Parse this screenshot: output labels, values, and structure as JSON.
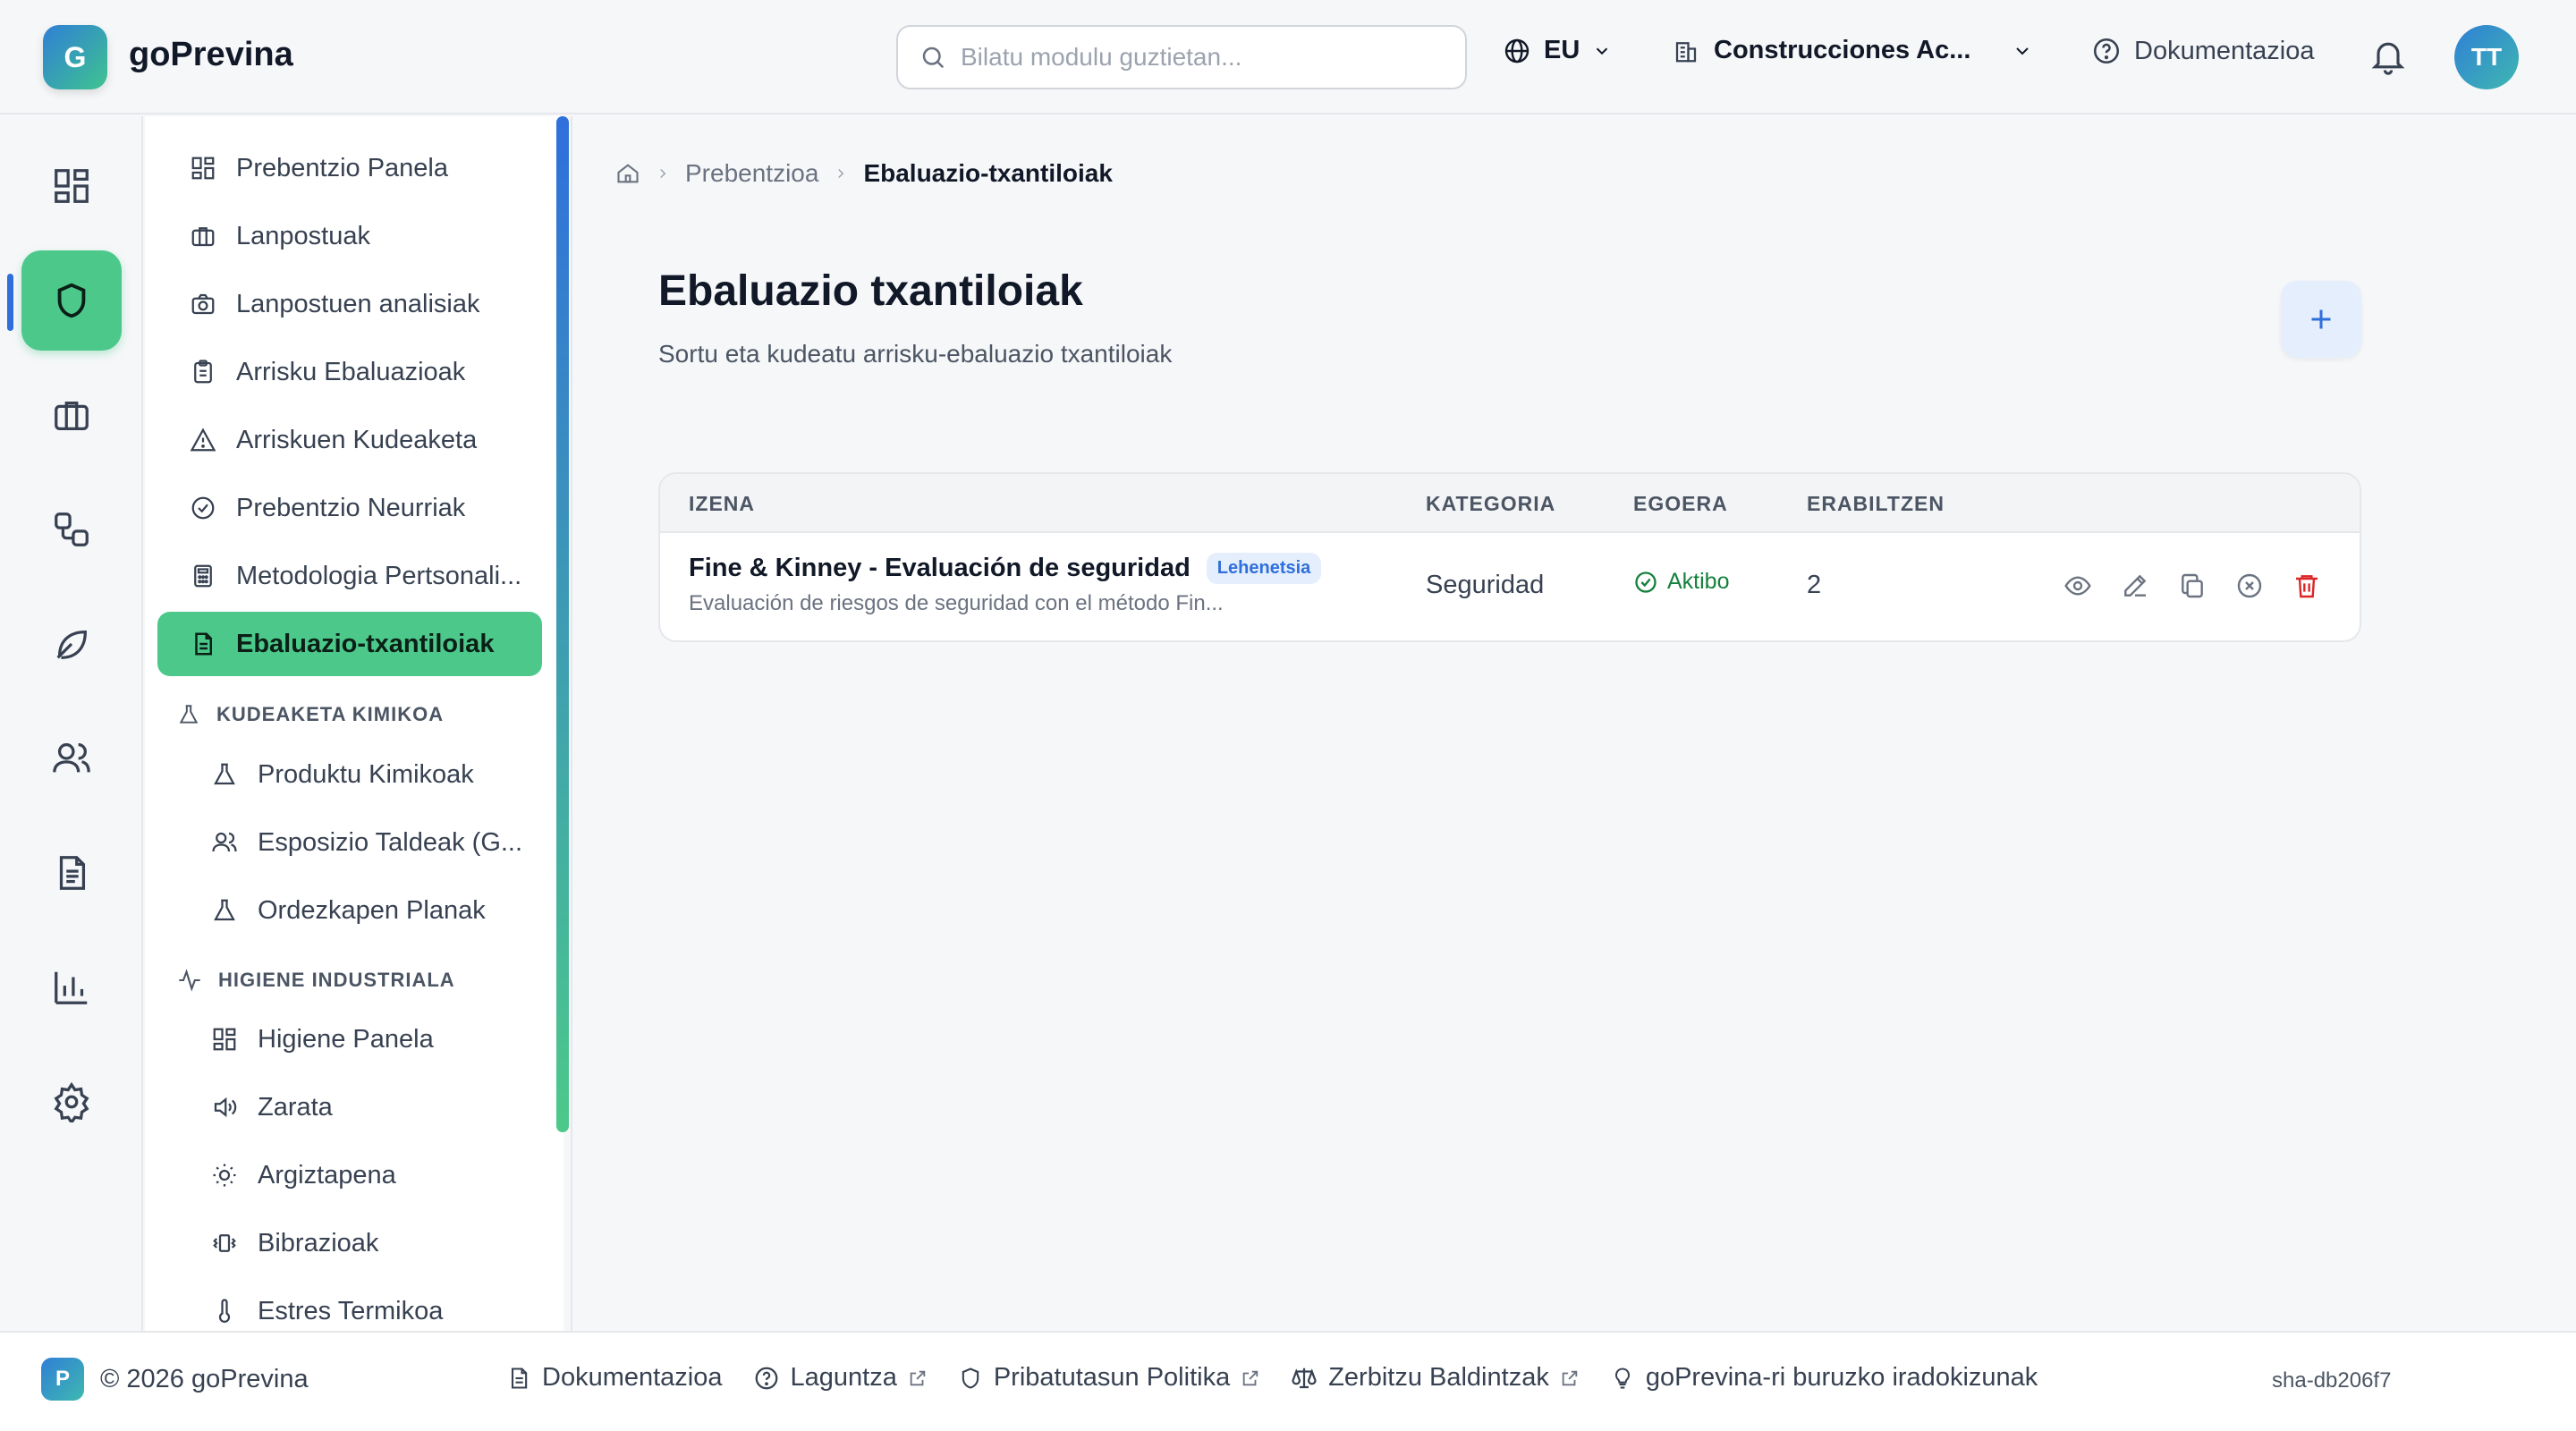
{
  "header": {
    "logo_letter": "G",
    "app_name": "goPrevina",
    "search_placeholder": "Bilatu modulu guztietan...",
    "language": "EU",
    "organization": "Construcciones Ac...",
    "docs_label": "Dokumentazioa",
    "avatar_initials": "TT"
  },
  "rail": {
    "items": [
      {
        "icon": "dashboard-icon",
        "active": false
      },
      {
        "icon": "shield-icon",
        "active": true
      },
      {
        "icon": "briefcase-icon",
        "active": false
      },
      {
        "icon": "shapes-icon",
        "active": false
      },
      {
        "icon": "leaf-icon",
        "active": false
      },
      {
        "icon": "users-icon",
        "active": false
      },
      {
        "icon": "document-icon",
        "active": false
      },
      {
        "icon": "bar-chart-icon",
        "active": false
      },
      {
        "icon": "gear-icon",
        "active": false
      }
    ]
  },
  "sidebar": {
    "items": [
      {
        "label": "Prebentzio Panela",
        "icon": "grid-icon"
      },
      {
        "label": "Lanpostuak",
        "icon": "briefcase-icon"
      },
      {
        "label": "Lanpostuen analisiak",
        "icon": "camera-icon"
      },
      {
        "label": "Arrisku Ebaluazioak",
        "icon": "clipboard-icon"
      },
      {
        "label": "Arriskuen Kudeaketa",
        "icon": "warning-icon"
      },
      {
        "label": "Prebentzio Neurriak",
        "icon": "check-circle-icon"
      },
      {
        "label": "Metodologia Pertsonali...",
        "icon": "calculator-icon"
      },
      {
        "label": "Ebaluazio-txantiloiak",
        "icon": "file-text-icon",
        "active": true
      }
    ],
    "section_chemical": {
      "label": "KUDEAKETA KIMIKOA",
      "items": [
        {
          "label": "Produktu Kimikoak",
          "icon": "flask-icon"
        },
        {
          "label": "Esposizio Taldeak (G...",
          "icon": "users-icon"
        },
        {
          "label": "Ordezkapen Planak",
          "icon": "flask-icon"
        }
      ]
    },
    "section_hygiene": {
      "label": "HIGIENE INDUSTRIALA",
      "items": [
        {
          "label": "Higiene Panela",
          "icon": "grid-icon"
        },
        {
          "label": "Zarata",
          "icon": "speaker-icon"
        },
        {
          "label": "Argiztapena",
          "icon": "sun-icon"
        },
        {
          "label": "Bibrazioak",
          "icon": "vibration-icon"
        },
        {
          "label": "Estres Termikoa",
          "icon": "thermometer-icon"
        }
      ]
    }
  },
  "breadcrumb": {
    "parent": "Prebentzioa",
    "current": "Ebaluazio-txantiloiak"
  },
  "page": {
    "title": "Ebaluazio txantiloiak",
    "subtitle": "Sortu eta kudeatu arrisku-ebaluazio txantiloiak"
  },
  "table": {
    "columns": [
      "IZENA",
      "KATEGORIA",
      "EGOERA",
      "ERABILTZEN"
    ],
    "rows": [
      {
        "name": "Fine & Kinney - Evaluación de seguridad",
        "badge": "Lehenetsia",
        "description": "Evaluación de riesgos de seguridad con el método Fin...",
        "category": "Seguridad",
        "status": "Aktibo",
        "used": "2"
      }
    ]
  },
  "footer": {
    "logo_letter": "P",
    "copyright": "© 2026 goPrevina",
    "links": [
      "Dokumentazioa",
      "Laguntza",
      "Pribatutasun Politika",
      "Zerbitzu Baldintzak",
      "goPrevina-ri buruzko iradokizunak"
    ],
    "sha": "sha-db206f7"
  },
  "colors": {
    "accent_green": "#4cc98a",
    "accent_blue": "#2f6fdc",
    "danger": "#dc2626",
    "success": "#15803d"
  }
}
